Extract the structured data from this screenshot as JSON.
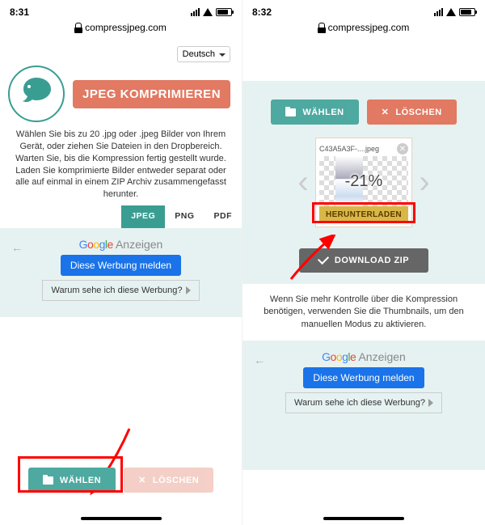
{
  "left": {
    "status_time": "8:31",
    "url": "compressjpeg.com",
    "language": "Deutsch",
    "page_title": "JPEG KOMPRIMIEREN",
    "intro_text": "Wählen Sie bis zu 20 .jpg oder .jpeg Bilder von Ihrem Gerät, oder ziehen Sie Dateien in den Dropbereich. Warten Sie, bis die Kompression fertig gestellt wurde. Laden Sie komprimierte Bilder entweder separat oder alle auf einmal in einem ZIP Archiv zusammengefasst herunter.",
    "tabs": {
      "jpeg": "JPEG",
      "png": "PNG",
      "pdf": "PDF"
    },
    "btn_select": "WÄHLEN",
    "btn_delete": "LÖSCHEN",
    "ad_brand": "Google",
    "ad_label": "Anzeigen",
    "ad_report": "Diese Werbung melden",
    "ad_why": "Warum sehe ich diese Werbung?"
  },
  "right": {
    "status_time": "8:32",
    "url": "compressjpeg.com",
    "btn_select": "WÄHLEN",
    "btn_delete": "LÖSCHEN",
    "thumb_filename": "C43A5A3F-....jpeg",
    "thumb_percent": "-21%",
    "thumb_download": "HERUNTERLADEN",
    "btn_zip": "DOWNLOAD ZIP",
    "control_text": "Wenn Sie mehr Kontrolle über die Kompression benötigen, verwenden Sie die Thumbnails, um den manuellen Modus zu aktivieren.",
    "ad_brand": "Google",
    "ad_label": "Anzeigen",
    "ad_report": "Diese Werbung melden",
    "ad_why": "Warum sehe ich diese Werbung?"
  }
}
